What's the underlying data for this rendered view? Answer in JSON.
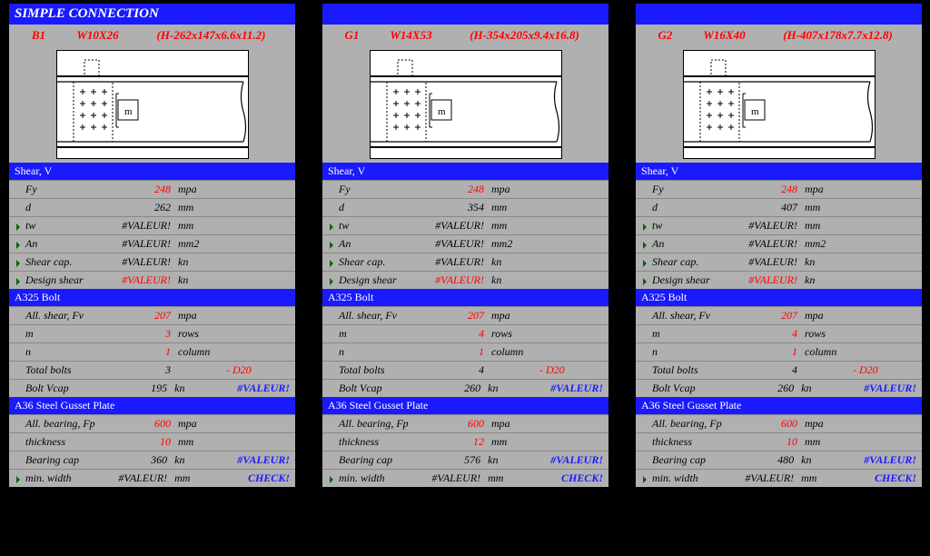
{
  "title": "SIMPLE CONNECTION",
  "cols": [
    {
      "id": "B1",
      "size": "W10X26",
      "dim": "(H-262x147x6.6x11.2)",
      "shear": [
        {
          "l": "Fy",
          "v": "248",
          "u": "mpa",
          "c": "r"
        },
        {
          "l": "d",
          "v": "262",
          "u": "mm",
          "c": "b"
        },
        {
          "l": "tw",
          "v": "#VALEUR!",
          "u": "mm",
          "c": "b",
          "t": 1
        },
        {
          "l": "An",
          "v": "#VALEUR!",
          "u": "mm2",
          "c": "b",
          "t": 1
        },
        {
          "l": "Shear cap.",
          "v": "#VALEUR!",
          "u": "kn",
          "c": "b",
          "t": 1
        },
        {
          "l": "Design shear",
          "v": "#VALEUR!",
          "u": "kn",
          "c": "r",
          "t": 1
        }
      ],
      "bolt": [
        {
          "l": "All. shear, Fv",
          "v": "207",
          "u": "mpa",
          "c": "r"
        },
        {
          "l": "m",
          "v": "3",
          "u": "rows",
          "c": "r"
        },
        {
          "l": "n",
          "v": "1",
          "u": "column",
          "c": "r"
        },
        {
          "l": "Total bolts",
          "v": "3",
          "u": "",
          "c": "b",
          "d": "- D20"
        },
        {
          "l": "Bolt Vcap",
          "v": "195",
          "u": "kn",
          "c": "b",
          "e": "#VALEUR!"
        }
      ],
      "plate": [
        {
          "l": "All. bearing, Fp",
          "v": "600",
          "u": "mpa",
          "c": "r"
        },
        {
          "l": "thickness",
          "v": "10",
          "u": "mm",
          "c": "r"
        },
        {
          "l": "Bearing cap",
          "v": "360",
          "u": "kn",
          "c": "b",
          "e": "#VALEUR!"
        },
        {
          "l": "min. width",
          "v": "#VALEUR!",
          "u": "mm",
          "c": "b",
          "t": 1,
          "e": "CHECK!"
        }
      ]
    },
    {
      "id": "G1",
      "size": "W14X53",
      "dim": "(H-354x205x9.4x16.8)",
      "shear": [
        {
          "l": "Fy",
          "v": "248",
          "u": "mpa",
          "c": "r"
        },
        {
          "l": "d",
          "v": "354",
          "u": "mm",
          "c": "b"
        },
        {
          "l": "tw",
          "v": "#VALEUR!",
          "u": "mm",
          "c": "b",
          "t": 1
        },
        {
          "l": "An",
          "v": "#VALEUR!",
          "u": "mm2",
          "c": "b",
          "t": 1
        },
        {
          "l": "Shear cap.",
          "v": "#VALEUR!",
          "u": "kn",
          "c": "b",
          "t": 1
        },
        {
          "l": "Design shear",
          "v": "#VALEUR!",
          "u": "kn",
          "c": "r",
          "t": 1
        }
      ],
      "bolt": [
        {
          "l": "All. shear, Fv",
          "v": "207",
          "u": "mpa",
          "c": "r"
        },
        {
          "l": "m",
          "v": "4",
          "u": "rows",
          "c": "r"
        },
        {
          "l": "n",
          "v": "1",
          "u": "column",
          "c": "r"
        },
        {
          "l": "Total bolts",
          "v": "4",
          "u": "",
          "c": "b",
          "d": "- D20"
        },
        {
          "l": "Bolt Vcap",
          "v": "260",
          "u": "kn",
          "c": "b",
          "e": "#VALEUR!"
        }
      ],
      "plate": [
        {
          "l": "All. bearing, Fp",
          "v": "600",
          "u": "mpa",
          "c": "r"
        },
        {
          "l": "thickness",
          "v": "12",
          "u": "mm",
          "c": "r"
        },
        {
          "l": "Bearing cap",
          "v": "576",
          "u": "kn",
          "c": "b",
          "e": "#VALEUR!"
        },
        {
          "l": "min. width",
          "v": "#VALEUR!",
          "u": "mm",
          "c": "b",
          "t": 1,
          "e": "CHECK!"
        }
      ]
    },
    {
      "id": "G2",
      "size": "W16X40",
      "dim": "(H-407x178x7.7x12.8)",
      "shear": [
        {
          "l": "Fy",
          "v": "248",
          "u": "mpa",
          "c": "r"
        },
        {
          "l": "d",
          "v": "407",
          "u": "mm",
          "c": "b"
        },
        {
          "l": "tw",
          "v": "#VALEUR!",
          "u": "mm",
          "c": "b",
          "t": 1
        },
        {
          "l": "An",
          "v": "#VALEUR!",
          "u": "mm2",
          "c": "b",
          "t": 1
        },
        {
          "l": "Shear cap.",
          "v": "#VALEUR!",
          "u": "kn",
          "c": "b",
          "t": 1
        },
        {
          "l": "Design shear",
          "v": "#VALEUR!",
          "u": "kn",
          "c": "r",
          "t": 1
        }
      ],
      "bolt": [
        {
          "l": "All. shear, Fv",
          "v": "207",
          "u": "mpa",
          "c": "r"
        },
        {
          "l": "m",
          "v": "4",
          "u": "rows",
          "c": "r"
        },
        {
          "l": "n",
          "v": "1",
          "u": "column",
          "c": "r"
        },
        {
          "l": "Total bolts",
          "v": "4",
          "u": "",
          "c": "b",
          "d": "- D20"
        },
        {
          "l": "Bolt Vcap",
          "v": "260",
          "u": "kn",
          "c": "b",
          "e": "#VALEUR!"
        }
      ],
      "plate": [
        {
          "l": "All. bearing, Fp",
          "v": "600",
          "u": "mpa",
          "c": "r"
        },
        {
          "l": "thickness",
          "v": "10",
          "u": "mm",
          "c": "r"
        },
        {
          "l": "Bearing cap",
          "v": "480",
          "u": "kn",
          "c": "b",
          "e": "#VALEUR!"
        },
        {
          "l": "min. width",
          "v": "#VALEUR!",
          "u": "mm",
          "c": "b",
          "t": 1,
          "e": "CHECK!"
        }
      ]
    }
  ],
  "sections": {
    "shear": "Shear, V",
    "bolt": "A325 Bolt",
    "plate": "A36 Steel Gusset Plate"
  }
}
